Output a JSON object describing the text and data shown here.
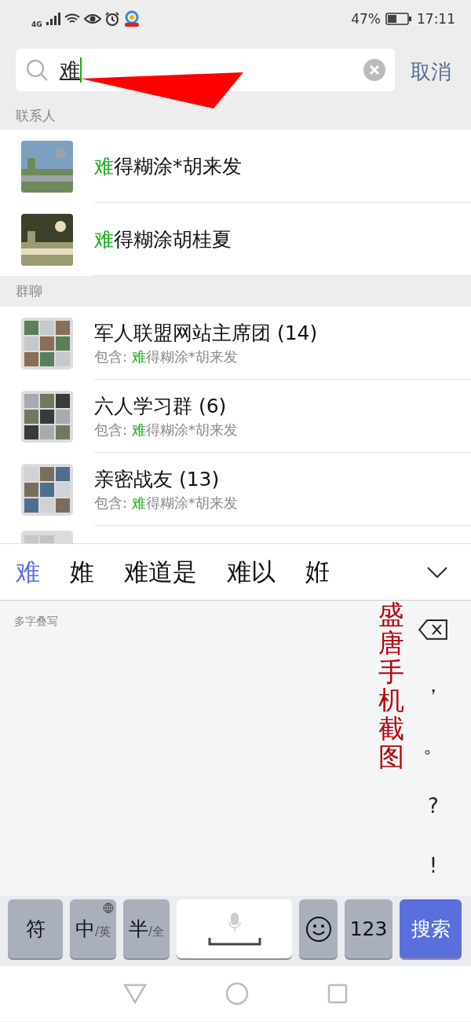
{
  "status_bar": {
    "network": "4G",
    "battery": "47%",
    "time": "17:11"
  },
  "search": {
    "value": "难",
    "cancel": "取消"
  },
  "sections": [
    {
      "title": "联系人",
      "kind": "contacts",
      "items": [
        {
          "match": "难",
          "rest": "得糊涂*胡来发"
        },
        {
          "match": "难",
          "rest": "得糊涂胡桂夏"
        }
      ]
    },
    {
      "title": "群聊",
      "kind": "groups",
      "items": [
        {
          "name": "军人联盟网站主席团 (14)",
          "prefix": "包含: ",
          "match": "难",
          "rest": "得糊涂*胡来发"
        },
        {
          "name": "六人学习群 (6)",
          "prefix": "包含: ",
          "match": "难",
          "rest": "得糊涂*胡来发"
        },
        {
          "name": "亲密战友 (13)",
          "prefix": "包含: ",
          "match": "难",
          "rest": "得糊涂*胡来发"
        }
      ],
      "clipped_item": {
        "kind": "picture"
      }
    }
  ],
  "candidates": [
    {
      "text": "难",
      "selected": true
    },
    {
      "text": "婎",
      "selected": false
    },
    {
      "text": "难道是",
      "selected": false
    },
    {
      "text": "难以",
      "selected": false
    },
    {
      "text": "姙",
      "selected": false
    }
  ],
  "handwriting": {
    "mode_label": "多字叠写",
    "punctuation": [
      "，",
      "。",
      "?",
      "!"
    ]
  },
  "annotation": {
    "text": "盛唐手机截图"
  },
  "keys": [
    {
      "kind": "text",
      "label": "符"
    },
    {
      "kind": "dual",
      "main": "中",
      "alt": "/英",
      "globe": true
    },
    {
      "kind": "dual",
      "main": "半",
      "alt": "/全",
      "globe": false
    },
    {
      "kind": "space"
    },
    {
      "kind": "emoji"
    },
    {
      "kind": "text",
      "label": "123"
    },
    {
      "kind": "action",
      "label": "搜索"
    }
  ]
}
